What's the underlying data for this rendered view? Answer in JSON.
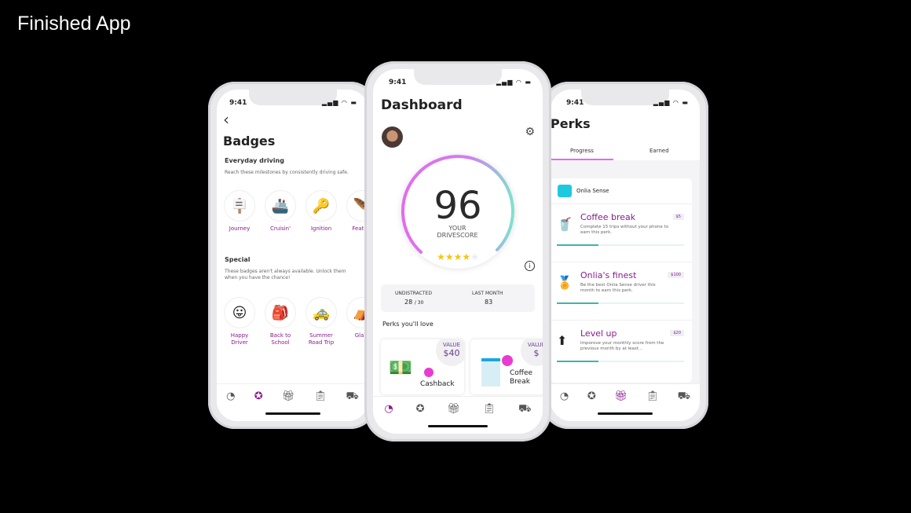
{
  "heading": "Finished App",
  "status": {
    "time": "9:41",
    "signal": "▂▄▆ ◠ ▬"
  },
  "badges_screen": {
    "title": "Badges",
    "back": "‹",
    "everyday": {
      "title": "Everyday driving",
      "desc": "Reach these milestones by consistently driving safe.",
      "items": [
        {
          "label": "Journey",
          "icon": "🪧"
        },
        {
          "label": "Cruisin'",
          "icon": "🚢"
        },
        {
          "label": "Ignition",
          "icon": "🔑"
        },
        {
          "label": "Feat Fo",
          "icon": "🪶"
        }
      ]
    },
    "special": {
      "title": "Special",
      "desc": "These badges aren't always available. Unlock them when you have the chance!",
      "items": [
        {
          "label": "Happy Driver",
          "icon": "😛"
        },
        {
          "label": "Back to School",
          "icon": "🎒"
        },
        {
          "label": "Summer Road Trip",
          "icon": "🚕"
        },
        {
          "label": "Glam",
          "icon": "⛺"
        }
      ]
    }
  },
  "dashboard": {
    "title": "Dashboard",
    "score": "96",
    "score_label": "YOUR DRIVESCORE",
    "rating": 4,
    "stars": "★★★★",
    "star_empty": "★",
    "stats": [
      {
        "label": "UNDISTRACTED",
        "value": "28",
        "suffix": "/ 30"
      },
      {
        "label": "LAST MONTH",
        "value": "83"
      }
    ],
    "perks_title": "Perks you'll love",
    "perks": [
      {
        "name": "Cashback",
        "value_label": "VALUE",
        "value": "$40"
      },
      {
        "name": "Coffee Break",
        "value_label": "VALUE",
        "value": "$"
      }
    ]
  },
  "perks_screen": {
    "title": "Perks",
    "tabs": [
      "Progress",
      "Earned"
    ],
    "brand": "Onlia Sense",
    "items": [
      {
        "title": "Coffee break",
        "desc": "Complete 15 trips without your phone to earn this perk.",
        "value": "$5",
        "progress": 33,
        "icon": "🥤"
      },
      {
        "title": "Onlia's finest",
        "desc": "Be the best Onlia Sense driver this month to earn this perk.",
        "value": "$100",
        "progress": 33,
        "icon": "🏅"
      },
      {
        "title": "Level up",
        "desc": "Imporove your monthly score from the previous month by at least...",
        "value": "$20",
        "progress": 33,
        "icon": "⬆"
      }
    ]
  },
  "tabbar": [
    "dashboard-icon",
    "badge-icon",
    "gift-icon",
    "clipboard-icon",
    "car-icon"
  ],
  "colors": {
    "accent": "#8b1a8f",
    "pink": "#e36af0",
    "teal": "#40b5a6",
    "star": "#f5c518"
  }
}
